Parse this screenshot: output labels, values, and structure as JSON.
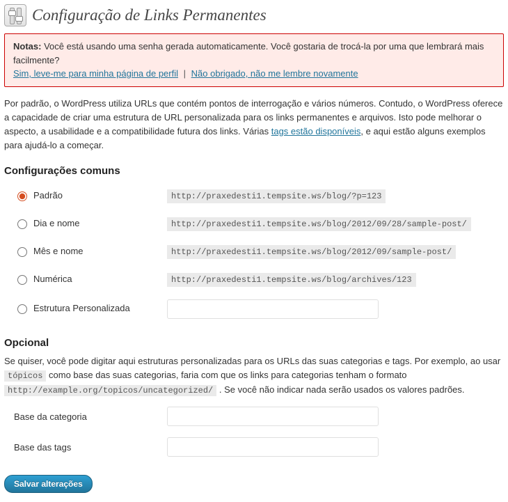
{
  "page": {
    "title": "Configuração de Links Permanentes"
  },
  "notice": {
    "label": "Notas:",
    "message": "Você está usando uma senha gerada automaticamente. Você gostaria de trocá-la por uma que lembrará mais facilmente?",
    "link_yes": "Sim, leve-me para minha página de perfil",
    "sep": "|",
    "link_no": "Não obrigado, não me lembre novamente"
  },
  "intro": {
    "part1": "Por padrão, o WordPress utiliza URLs que contém pontos de interrogação e vários números. Contudo, o WordPress oferece a capacidade de criar uma estrutura de URL personalizada para os links permanentes e arquivos. Isto pode melhorar o aspecto, a usabilidade e a compatibilidade futura dos links. Várias ",
    "link": "tags estão disponíveis",
    "part2": ", e aqui estão alguns exemplos para ajudá-lo a começar."
  },
  "sections": {
    "common": "Configurações comuns",
    "optional": "Opcional"
  },
  "permalink_options": [
    {
      "key": "default",
      "label": "Padrão",
      "example": "http://praxedesti1.tempsite.ws/blog/?p=123",
      "checked": true
    },
    {
      "key": "dayname",
      "label": "Dia e nome",
      "example": "http://praxedesti1.tempsite.ws/blog/2012/09/28/sample-post/",
      "checked": false
    },
    {
      "key": "monthname",
      "label": "Mês e nome",
      "example": "http://praxedesti1.tempsite.ws/blog/2012/09/sample-post/",
      "checked": false
    },
    {
      "key": "numeric",
      "label": "Numérica",
      "example": "http://praxedesti1.tempsite.ws/blog/archives/123",
      "checked": false
    },
    {
      "key": "custom",
      "label": "Estrutura Personalizada",
      "example": "",
      "checked": false
    }
  ],
  "custom_value": "",
  "optional_desc": {
    "part1": "Se quiser, você pode digitar aqui estruturas personalizadas para os URLs das suas categorias e tags. Por exemplo, ao usar ",
    "code1": "tópicos",
    "part2": " como base das suas categorias, faria com que os links para categorias tenham o formato ",
    "code2": "http://example.org/topicos/uncategorized/",
    "part3": " . Se você não indicar nada serão usados os valores padrões."
  },
  "optional_fields": {
    "category_base_label": "Base da categoria",
    "category_base_value": "",
    "tag_base_label": "Base das tags",
    "tag_base_value": ""
  },
  "buttons": {
    "save": "Salvar alterações"
  }
}
